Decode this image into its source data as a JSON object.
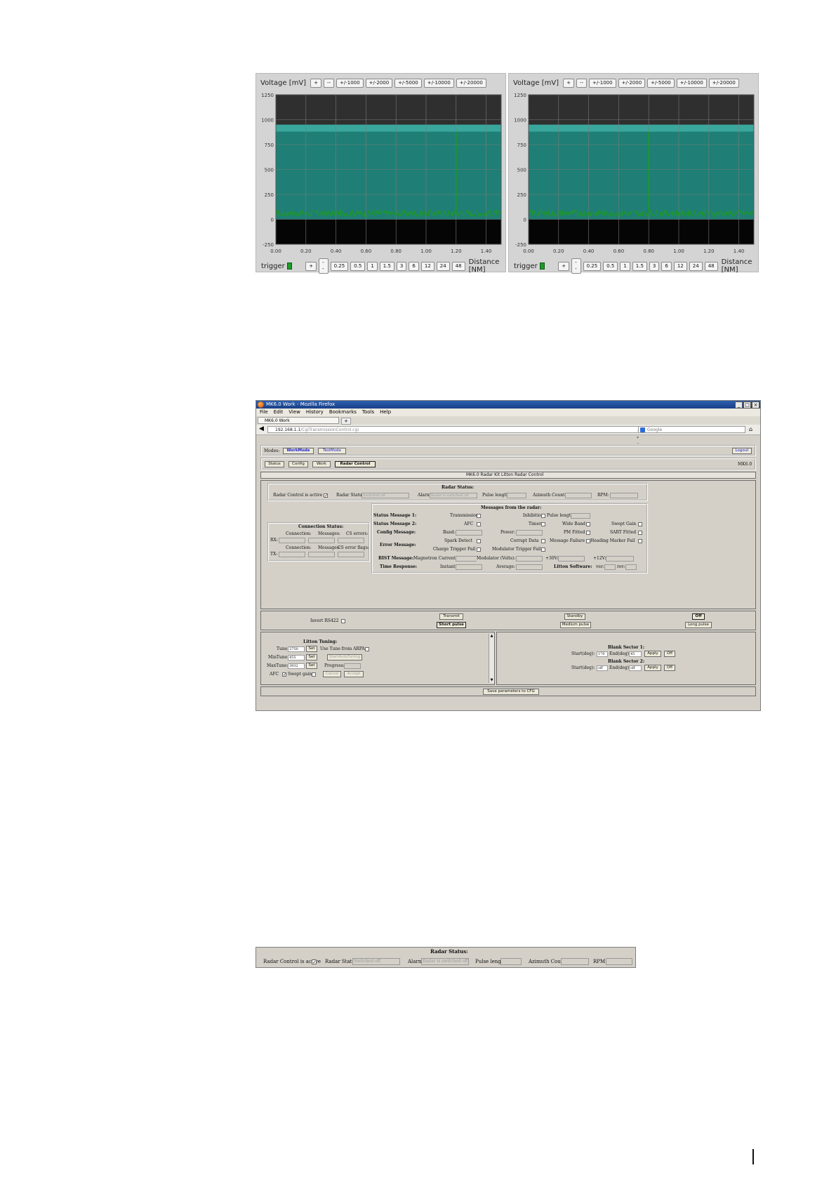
{
  "scope_left": {
    "voltage_label": "Voltage [mV]",
    "voltage_buttons": [
      "+",
      "--",
      "+/-1000",
      "+/-2000",
      "+/-5000",
      "+/-10000",
      "+/-20000"
    ],
    "y_ticks": [
      "1250",
      "1000",
      "750",
      "500",
      "250",
      "0",
      "-250"
    ],
    "x_ticks": [
      "0.00",
      "0.20",
      "0.40",
      "0.60",
      "0.80",
      "1.00",
      "1.20",
      "1.40"
    ],
    "trigger_label": "trigger",
    "distance_buttons": [
      "+",
      "--",
      "0.25",
      "0.5",
      "1",
      "1.5",
      "3",
      "6",
      "12",
      "24",
      "48"
    ],
    "distance_label": "Distance [NM]",
    "spike_distance_nm": 1.2,
    "colors": {
      "background": "#2f2f2f",
      "band": "#1f7f76",
      "trace": "#1e9a22",
      "grid": "#7a7a7a"
    }
  },
  "scope_right": {
    "voltage_label": "Voltage [mV]",
    "voltage_buttons": [
      "+",
      "--",
      "+/-1000",
      "+/-2000",
      "+/-5000",
      "+/-10000",
      "+/-20000"
    ],
    "y_ticks": [
      "1250",
      "1000",
      "750",
      "500",
      "250",
      "0",
      "-250"
    ],
    "x_ticks": [
      "0.00",
      "0.20",
      "0.40",
      "0.60",
      "0.80",
      "1.00",
      "1.20",
      "1.40"
    ],
    "trigger_label": "trigger",
    "distance_buttons": [
      "+",
      "--",
      "0.25",
      "0.5",
      "1",
      "1.5",
      "3",
      "6",
      "12",
      "24",
      "48"
    ],
    "distance_label": "Distance [NM]",
    "spike_distance_nm": 0.8
  },
  "browser": {
    "title": "MK6.0 Work - Mozilla Firefox",
    "menu": [
      "File",
      "Edit",
      "View",
      "History",
      "Bookmarks",
      "Tools",
      "Help"
    ],
    "tab_title": "MK6.0 Work",
    "new_tab": "+",
    "url_host": "192.168.1.1",
    "url_path": "/CgiTransmissionControl.cgi",
    "search_placeholder": "Google",
    "modes_label": "Modes:",
    "mode_work": "WorkMode",
    "mode_test": "TestMode",
    "logout": "Logout",
    "nav": [
      "Status",
      "Config",
      "Work",
      "Radar Control"
    ],
    "version": "MK6.0",
    "page_title": "MK6.0 Radar Kit Litton Radar Control",
    "radar_status": {
      "heading": "Radar Status:",
      "control_active_label": "Radar Control is active",
      "status_label": "Radar Status:",
      "status_value": "Switched off",
      "alarm_label": "Alarm:",
      "alarm_value": "Radar is switched off",
      "pulse_label": "Pulse length:",
      "azimuth_label": "Azimuth Count:",
      "rpm_label": "RPM:"
    },
    "connection": {
      "heading": "Connection Status:",
      "row1": [
        "Connection:",
        "Messages:",
        "CS errors:"
      ],
      "row2": [
        "Connection:",
        "Messages:",
        "CS error flags:"
      ],
      "rx": "RX:",
      "tx": "TX:"
    },
    "messages": {
      "heading": "Messages from the radar:",
      "sm1": "Status Message 1:",
      "sm2": "Status Message 2:",
      "cfg": "Config Message:",
      "err": "Error Message:",
      "bist": "BIST Message:",
      "time": "Time Response:",
      "transmission": "Transmission",
      "inhibition": "Inhibition",
      "pulse_length": "Pulse length:",
      "afc": "AFC",
      "timer": "Timer",
      "wide_band": "Wide Band",
      "swept_gain": "Swept Gain",
      "band": "Band:",
      "power": "Power:",
      "pm_fitted": "PM Fitted",
      "sart_fitted": "SART Fitted",
      "spark_detect": "Spark Detect",
      "corrupt_data": "Corrupt Data",
      "message_failure": "Message Failure",
      "heading_marker_fail": "Heading Marker Fail",
      "charge_trigger_fail": "Charge Trigger Fail",
      "modulator_trigger_fail": "Modulator Trigger Fail",
      "magnetron_current": "Magnetron Current:",
      "modulator_volts": "Modulator (Volts):",
      "v30": "+30V:",
      "v12": "+12V:",
      "instant": "Instant:",
      "average": "Average:",
      "litton_software": "Litton Software:",
      "ver": "ver:",
      "rev": "rev:"
    },
    "controls": {
      "invert": "Invert RS422",
      "transmit": "Transmit",
      "short_pulse": "Short pulse",
      "standby": "Standby",
      "medium_pulse": "Medium pulse",
      "off": "Off",
      "long_pulse": "Long pulse"
    },
    "tuning": {
      "heading": "Litton Tuning:",
      "tune_label": "Tune:",
      "tune_value": "2750",
      "min_label": "MinTune:",
      "min_value": "455",
      "max_label": "MaxTune:",
      "max_value": "3932",
      "set": "Set",
      "use_time_arpa": "Use Tune from ARPA",
      "start_auto": "StartAutoTuning",
      "progress": "Progress:",
      "afc": "AFC",
      "swept_gain": "Swept gain",
      "cancel": "Cancel",
      "accept": "Accept"
    },
    "blank": {
      "s1_heading": "Blank Sector 1:",
      "s1_start_label": "Start(deg):",
      "s1_start": "170",
      "s1_end_label": "End(deg):",
      "s1_end": "45",
      "s2_heading": "Blank Sector 2:",
      "s2_start_label": "Start(deg):",
      "s2_start": "off",
      "s2_end_label": "End(deg):",
      "s2_end": "off",
      "apply": "Apply",
      "off": "Off"
    },
    "save": "Save parameters to CFG"
  },
  "strip": {
    "heading": "Radar Status:",
    "control_active_label": "Radar Control is active",
    "status_label": "Radar Status:",
    "status_value": "Switched off",
    "alarm_label": "Alarm:",
    "alarm_value": "Radar is switched off",
    "pulse_label": "Pulse length:",
    "azimuth_label": "Azimuth Count:",
    "rpm_label": "RPM:"
  }
}
